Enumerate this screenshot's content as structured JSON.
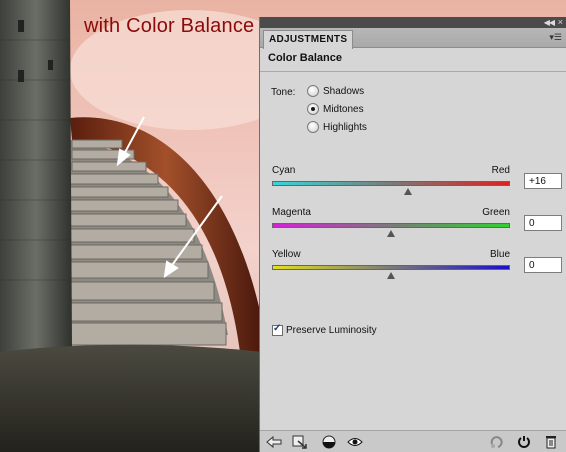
{
  "overlay": {
    "caption": "with Color Balance"
  },
  "panel": {
    "tab_label": "ADJUSTMENTS",
    "title": "Color Balance",
    "tone": {
      "label": "Tone:",
      "options": [
        "Shadows",
        "Midtones",
        "Highlights"
      ],
      "selected": "Midtones"
    },
    "sliders": [
      {
        "left": "Cyan",
        "right": "Red",
        "value": "+16",
        "position": 0.57,
        "colors": [
          "#39d5d8",
          "#e02020"
        ]
      },
      {
        "left": "Magenta",
        "right": "Green",
        "value": "0",
        "position": 0.5,
        "colors": [
          "#d81ed8",
          "#30d030"
        ]
      },
      {
        "left": "Yellow",
        "right": "Blue",
        "value": "0",
        "position": 0.5,
        "colors": [
          "#e2df20",
          "#1a10c8"
        ]
      }
    ],
    "preserve_luminosity": {
      "label": "Preserve Luminosity",
      "checked": true
    }
  },
  "icons": {
    "topbar": [
      "collapse-icon",
      "close-icon"
    ],
    "tab_menu": "panel-menu-icon",
    "bottom": [
      "return-arrow-icon",
      "clip-to-layer-icon",
      "visibility-toggle-circle-icon",
      "eye-icon",
      "reset-icon",
      "previous-state-icon",
      "trash-icon"
    ]
  }
}
